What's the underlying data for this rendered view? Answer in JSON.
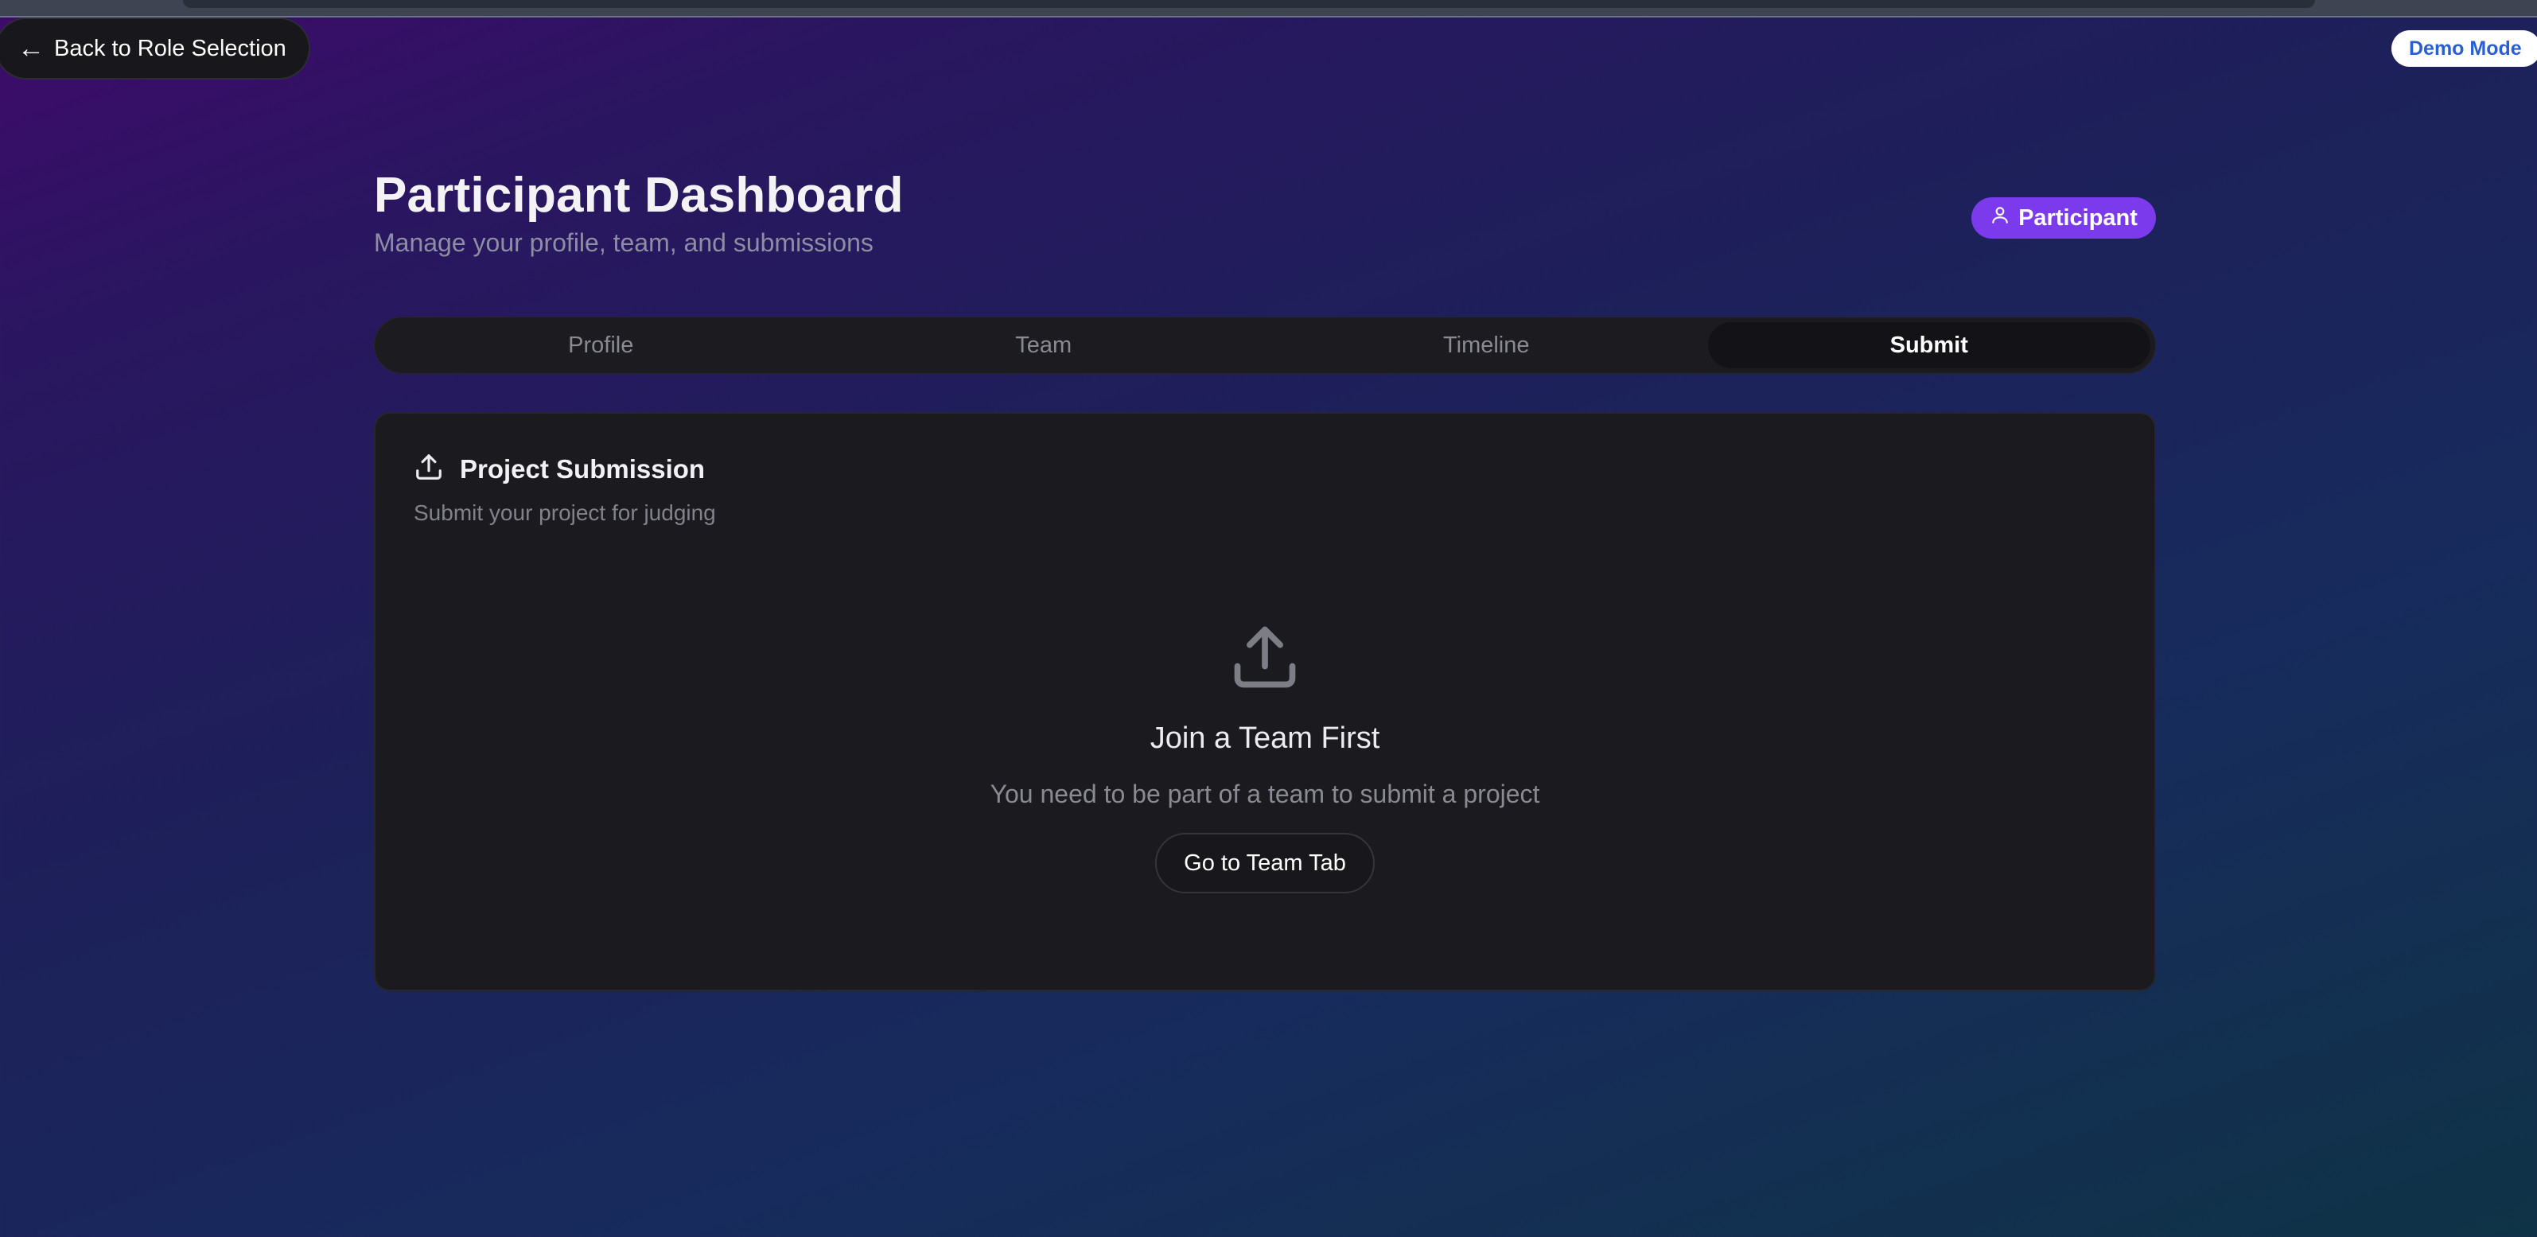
{
  "nav": {
    "back_label": "Back to Role Selection",
    "back_icon": "arrow-left-icon",
    "demo_badge": "Demo Mode"
  },
  "header": {
    "title": "Participant Dashboard",
    "subtitle": "Manage your profile, team, and submissions",
    "role_badge": "Participant",
    "role_icon": "user-icon"
  },
  "tabs": [
    {
      "label": "Profile",
      "active": false
    },
    {
      "label": "Team",
      "active": false
    },
    {
      "label": "Timeline",
      "active": false
    },
    {
      "label": "Submit",
      "active": true
    }
  ],
  "submission_card": {
    "title": "Project Submission",
    "title_icon": "upload-icon",
    "subtitle": "Submit your project for judging",
    "empty_state": {
      "icon": "upload-icon",
      "title": "Join a Team First",
      "message": "You need to be part of a team to submit a project",
      "button_label": "Go to Team Tab"
    }
  },
  "colors": {
    "accent": "#7c3aed",
    "demo_text": "#2b5fd0",
    "card_bg": "#1b1b1f"
  }
}
